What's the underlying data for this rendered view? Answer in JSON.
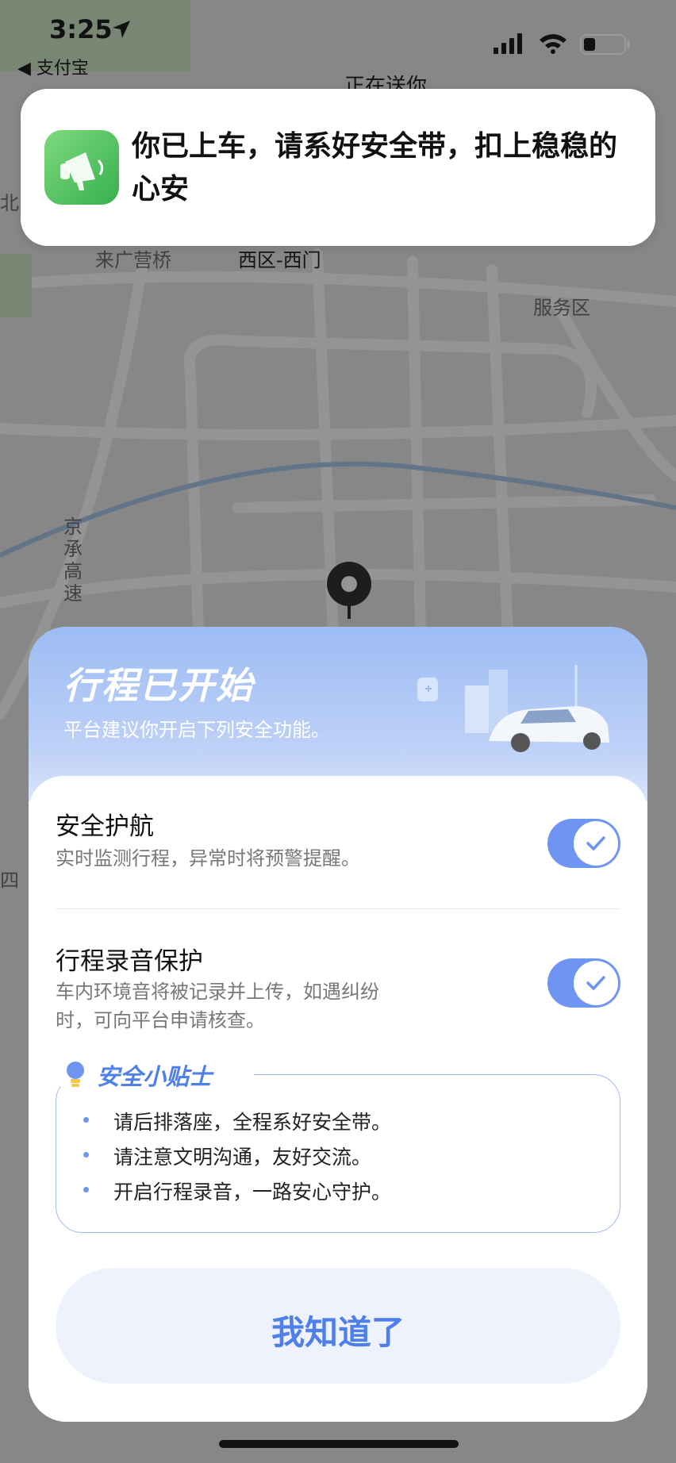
{
  "status_bar": {
    "time": "3:25",
    "back_app": "◀ 支付宝"
  },
  "map": {
    "pill_text": "正在送你",
    "labels": [
      "来广营桥",
      "西区-西门",
      "服务区",
      "京承高速",
      "北",
      "四"
    ]
  },
  "notification": {
    "text": "你已上车，请系好安全带，扣上稳稳的心安",
    "icon": "megaphone-icon"
  },
  "sheet": {
    "title": "行程已开始",
    "subtitle": "平台建议你开启下列安全功能。",
    "features": [
      {
        "title": "安全护航",
        "desc": "实时监测行程，异常时将预警提醒。",
        "enabled": true
      },
      {
        "title": "行程录音保护",
        "desc": "车内环境音将被记录并上传，如遇纠纷时，可向平台申请核查。",
        "enabled": true
      }
    ],
    "tips": {
      "title": "安全小贴士",
      "items": [
        "请后排落座，全程系好安全带。",
        "请注意文明沟通，友好交流。",
        "开启行程录音，一路安心守护。"
      ]
    },
    "confirm_label": "我知道了"
  },
  "colors": {
    "accent": "#4f7fe8",
    "toggle_on": "#6d95f1",
    "header_gradient_top": "#9cbcf4"
  }
}
